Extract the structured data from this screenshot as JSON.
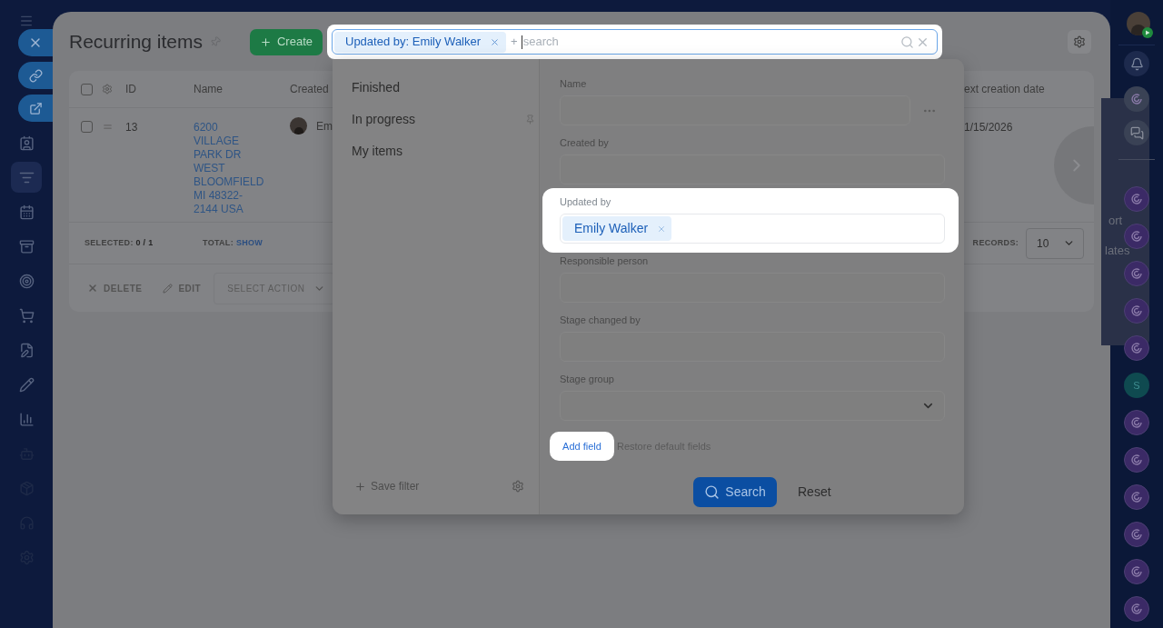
{
  "left_sidebar": {
    "pinned_actions": [
      {
        "kind": "close"
      },
      {
        "kind": "link"
      },
      {
        "kind": "external"
      }
    ],
    "items": [
      {
        "selected": false
      },
      {
        "selected": true
      },
      {
        "selected": false
      },
      {
        "selected": false
      },
      {
        "selected": false
      },
      {
        "selected": false
      },
      {
        "selected": false
      },
      {
        "selected": false
      },
      {
        "selected": false
      },
      {
        "selected": false
      },
      {
        "selected": false
      },
      {
        "selected": false
      },
      {
        "selected": false
      }
    ]
  },
  "header": {
    "title": "Recurring items",
    "create_button": "Create"
  },
  "search_bar": {
    "highlighted": true,
    "tags": [
      {
        "label": "Updated by: Emily Walker"
      }
    ],
    "add_sign": "+",
    "placeholder": "search"
  },
  "table": {
    "header_checked": false,
    "columns": [
      "ID",
      "Name",
      "Created",
      "ext creation date"
    ],
    "rows": [
      {
        "checked": false,
        "id": "13",
        "name": "6200 VILLAGE PARK DR WEST BLOOMFIELD MI 48322-2144 USA",
        "created_by": "Em",
        "next_creation_date": "1/15/2026"
      }
    ]
  },
  "footer": {
    "selected_label": "SELECTED:",
    "selected_value": "0 / 1",
    "total_label": "TOTAL:",
    "total_link": "SHOW",
    "records_label": "RECORDS:",
    "records_value": "10"
  },
  "actions": {
    "delete": "DELETE",
    "edit": "EDIT",
    "select_action": "SELECT ACTION"
  },
  "filter_panel": {
    "presets": [
      {
        "label": "Finished",
        "pinned": false
      },
      {
        "label": "In progress",
        "pinned": true
      },
      {
        "label": "My items",
        "pinned": false
      }
    ],
    "save_filter": "Save filter",
    "fields": [
      {
        "kind": "text",
        "label": "Name",
        "highlighted": false,
        "menu": true
      },
      {
        "kind": "text",
        "label": "Created by",
        "highlighted": false,
        "menu": false
      },
      {
        "kind": "people",
        "label": "Updated by",
        "highlighted": true,
        "menu": false,
        "tags": [
          "Emily Walker"
        ]
      },
      {
        "kind": "text",
        "label": "Responsible person",
        "highlighted": false,
        "menu": false
      },
      {
        "kind": "text",
        "label": "Stage changed by",
        "highlighted": false,
        "menu": false
      },
      {
        "kind": "select",
        "label": "Stage group",
        "highlighted": false,
        "menu": false
      }
    ],
    "add_field": {
      "label": "Add field",
      "highlighted": true
    },
    "restore": "Restore default fields",
    "search_button": "Search",
    "reset_button": "Reset"
  },
  "right_sidebar": {
    "flyout": [
      "ort",
      "lates"
    ],
    "apps": [
      {
        "kind": "app"
      },
      {
        "kind": "app"
      },
      {
        "kind": "app"
      },
      {
        "kind": "app"
      },
      {
        "kind": "app"
      },
      {
        "kind": "letter",
        "text": "S"
      },
      {
        "kind": "app"
      },
      {
        "kind": "app"
      },
      {
        "kind": "app"
      },
      {
        "kind": "app"
      },
      {
        "kind": "app"
      },
      {
        "kind": "app"
      }
    ]
  }
}
